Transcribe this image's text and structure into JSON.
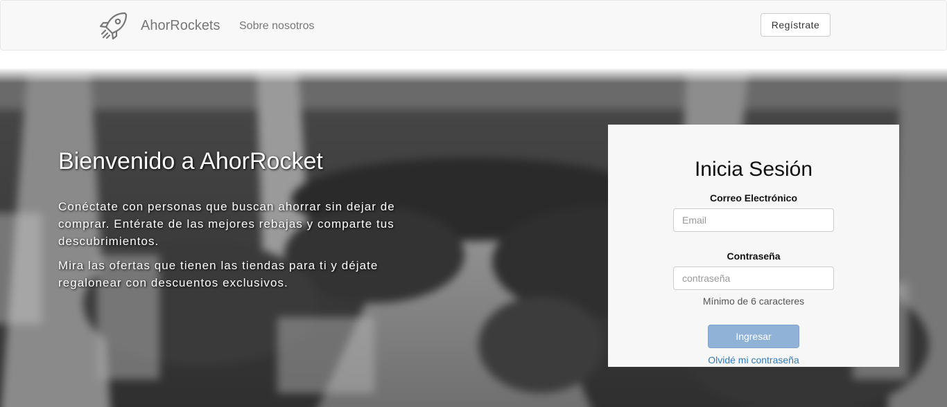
{
  "navbar": {
    "brand_icon": "rocket-icon",
    "brand_name": "AhorRockets",
    "links": [
      {
        "label": "Sobre nosotros"
      }
    ],
    "register_label": "Regístrate"
  },
  "hero": {
    "title": "Bienvenido a AhorRocket",
    "paragraphs": [
      "Conéctate con personas que buscan ahorrar sin dejar de comprar. Entérate de las mejores rebajas y comparte tus descubrimientos.",
      "Mira las ofertas que tienen las tiendas para ti y déjate regalonear con descuentos exclusivos."
    ]
  },
  "login": {
    "title": "Inicia Sesión",
    "email_label": "Correo Electrónico",
    "email_placeholder": "Email",
    "password_label": "Contraseña",
    "password_placeholder": "contraseña",
    "password_help": "Mínimo de 6 caracteres",
    "submit_label": "Ingresar",
    "forgot_label": "Olvidé mi contraseña"
  },
  "colors": {
    "navbar_bg": "#f8f8f8",
    "nav_text": "#777777",
    "panel_bg": "#f7f7f7",
    "submit_bg": "#8fb2d6",
    "link": "#337ab7"
  }
}
